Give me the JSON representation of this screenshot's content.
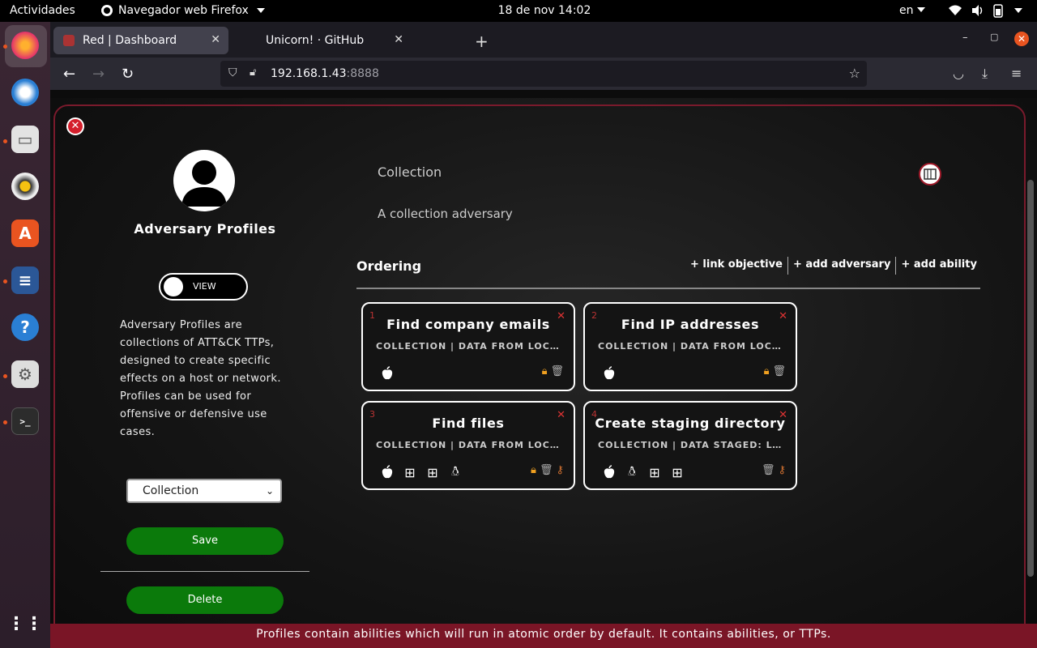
{
  "topbar": {
    "activities": "Actividades",
    "app_menu": "Navegador web Firefox",
    "clock": "18 de nov  14:02",
    "language": "en"
  },
  "browser": {
    "tabs": [
      {
        "label": "Red | Dashboard",
        "active": true
      },
      {
        "label": "Unicorn! · GitHub",
        "active": false
      }
    ],
    "url_host": "192.168.1.43",
    "url_port": ":8888"
  },
  "profile": {
    "title": "Adversary Profiles",
    "toggle_label": "VIEW",
    "description": "Adversary Profiles are collections of ATT&CK TTPs, designed to create specific effects on a host or network. Profiles can be used for offensive or defensive use cases.",
    "selected_profile": "Collection",
    "save_label": "Save",
    "delete_label": "Delete"
  },
  "adversary": {
    "name": "Collection",
    "description": "A collection adversary"
  },
  "ordering": {
    "heading": "Ordering",
    "actions": [
      "+ link objective",
      "+ add adversary",
      "+ add ability"
    ]
  },
  "abilities": [
    {
      "num": "1",
      "title": "Find company emails",
      "tactic": "COLLECTION  |  DATA FROM LOCAL SYSTEM",
      "platforms": [
        "apple"
      ],
      "badges": [
        "lock",
        "trash"
      ]
    },
    {
      "num": "2",
      "title": "Find IP addresses",
      "tactic": "COLLECTION  |  DATA FROM LOCAL SYSTEM",
      "platforms": [
        "apple"
      ],
      "badges": [
        "lock",
        "trash"
      ]
    },
    {
      "num": "3",
      "title": "Find files",
      "tactic": "COLLECTION  |  DATA FROM LOCAL SYSTEM",
      "platforms": [
        "apple",
        "windows",
        "windows",
        "linux"
      ],
      "badges": [
        "lock",
        "trash",
        "key"
      ]
    },
    {
      "num": "4",
      "title": "Create staging directory",
      "tactic": "COLLECTION  |  DATA STAGED: LOCAL DATA STAGING",
      "platforms": [
        "apple",
        "linux",
        "windows",
        "windows"
      ],
      "badges": [
        "trash",
        "key"
      ]
    }
  ],
  "footer": "Profiles contain abilities which will run in atomic order by default. It contains abilities, or TTPs.",
  "colors": {
    "accent": "#7a1526",
    "button_green": "#0b7a0b",
    "panel_border": "#7a1a2c"
  }
}
